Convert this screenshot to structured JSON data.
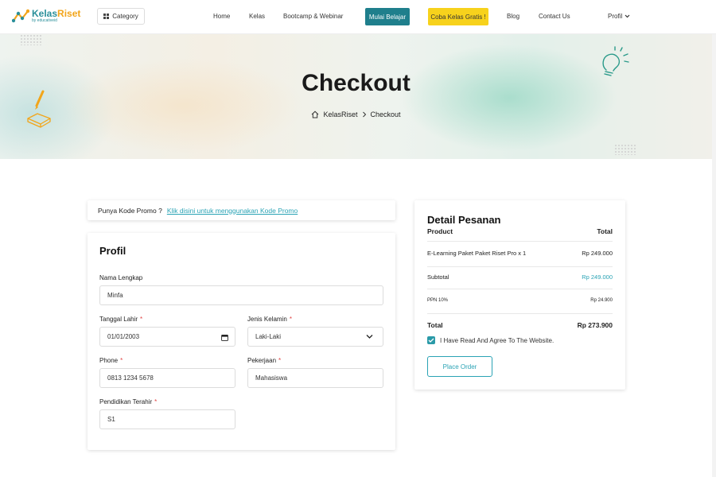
{
  "nav": {
    "logo_kelas": "Kelas",
    "logo_riset": "Riset",
    "logo_sub": "by educativeid",
    "category_label": "Category",
    "links": [
      "Home",
      "Kelas",
      "Bootcamp & Webinar"
    ],
    "mulai_belajar": "Mulai Belajar",
    "coba_kelas": "Coba Kelas Gratis !",
    "blog": "Blog",
    "contact": "Contact Us",
    "profil": "Profil"
  },
  "hero": {
    "title": "Checkout",
    "breadcrumb_home": "KelasRiset",
    "breadcrumb_current": "Checkout"
  },
  "promo": {
    "question": "Punya Kode Promo ?",
    "link_text": "Klik disini untuk menggunakan Kode Promo"
  },
  "profil": {
    "title": "Profil",
    "nama_label": "Nama Lengkap",
    "nama_value": "Minfa",
    "tanggal_label": "Tanggal Lahir",
    "tanggal_value": "01/01/2003",
    "jenis_label": "Jenis Kelamin",
    "jenis_value": "Laki-Laki",
    "phone_label": "Phone",
    "phone_value": "0813 1234 5678",
    "pekerjaan_label": "Pekerjaan",
    "pekerjaan_value": "Mahasiswa",
    "pendidikan_label": "Pendidikan Terahir",
    "pendidikan_value": "S1",
    "required_mark": "*"
  },
  "detail": {
    "title": "Detail Pesanan",
    "col_product": "Product",
    "col_total": "Total",
    "item_name": "E-Learning Paket Paket Riset Pro x 1",
    "item_price": "Rp 249.000",
    "subtotal_label": "Subtotal",
    "subtotal_value": "Rp 249.000",
    "ppn_label": "PPN 10%",
    "ppn_value": "Rp 24.900",
    "total_label": "Total",
    "total_value": "Rp 273.900",
    "agree_text": "I Have Read And Agree To The Website.",
    "agree_checked": true,
    "place_order": "Place Order"
  },
  "colors": {
    "brand_teal": "#1f7f8c",
    "accent_yellow": "#f7d21c",
    "link_teal": "#2aa3b5",
    "required_red": "#e04545"
  }
}
